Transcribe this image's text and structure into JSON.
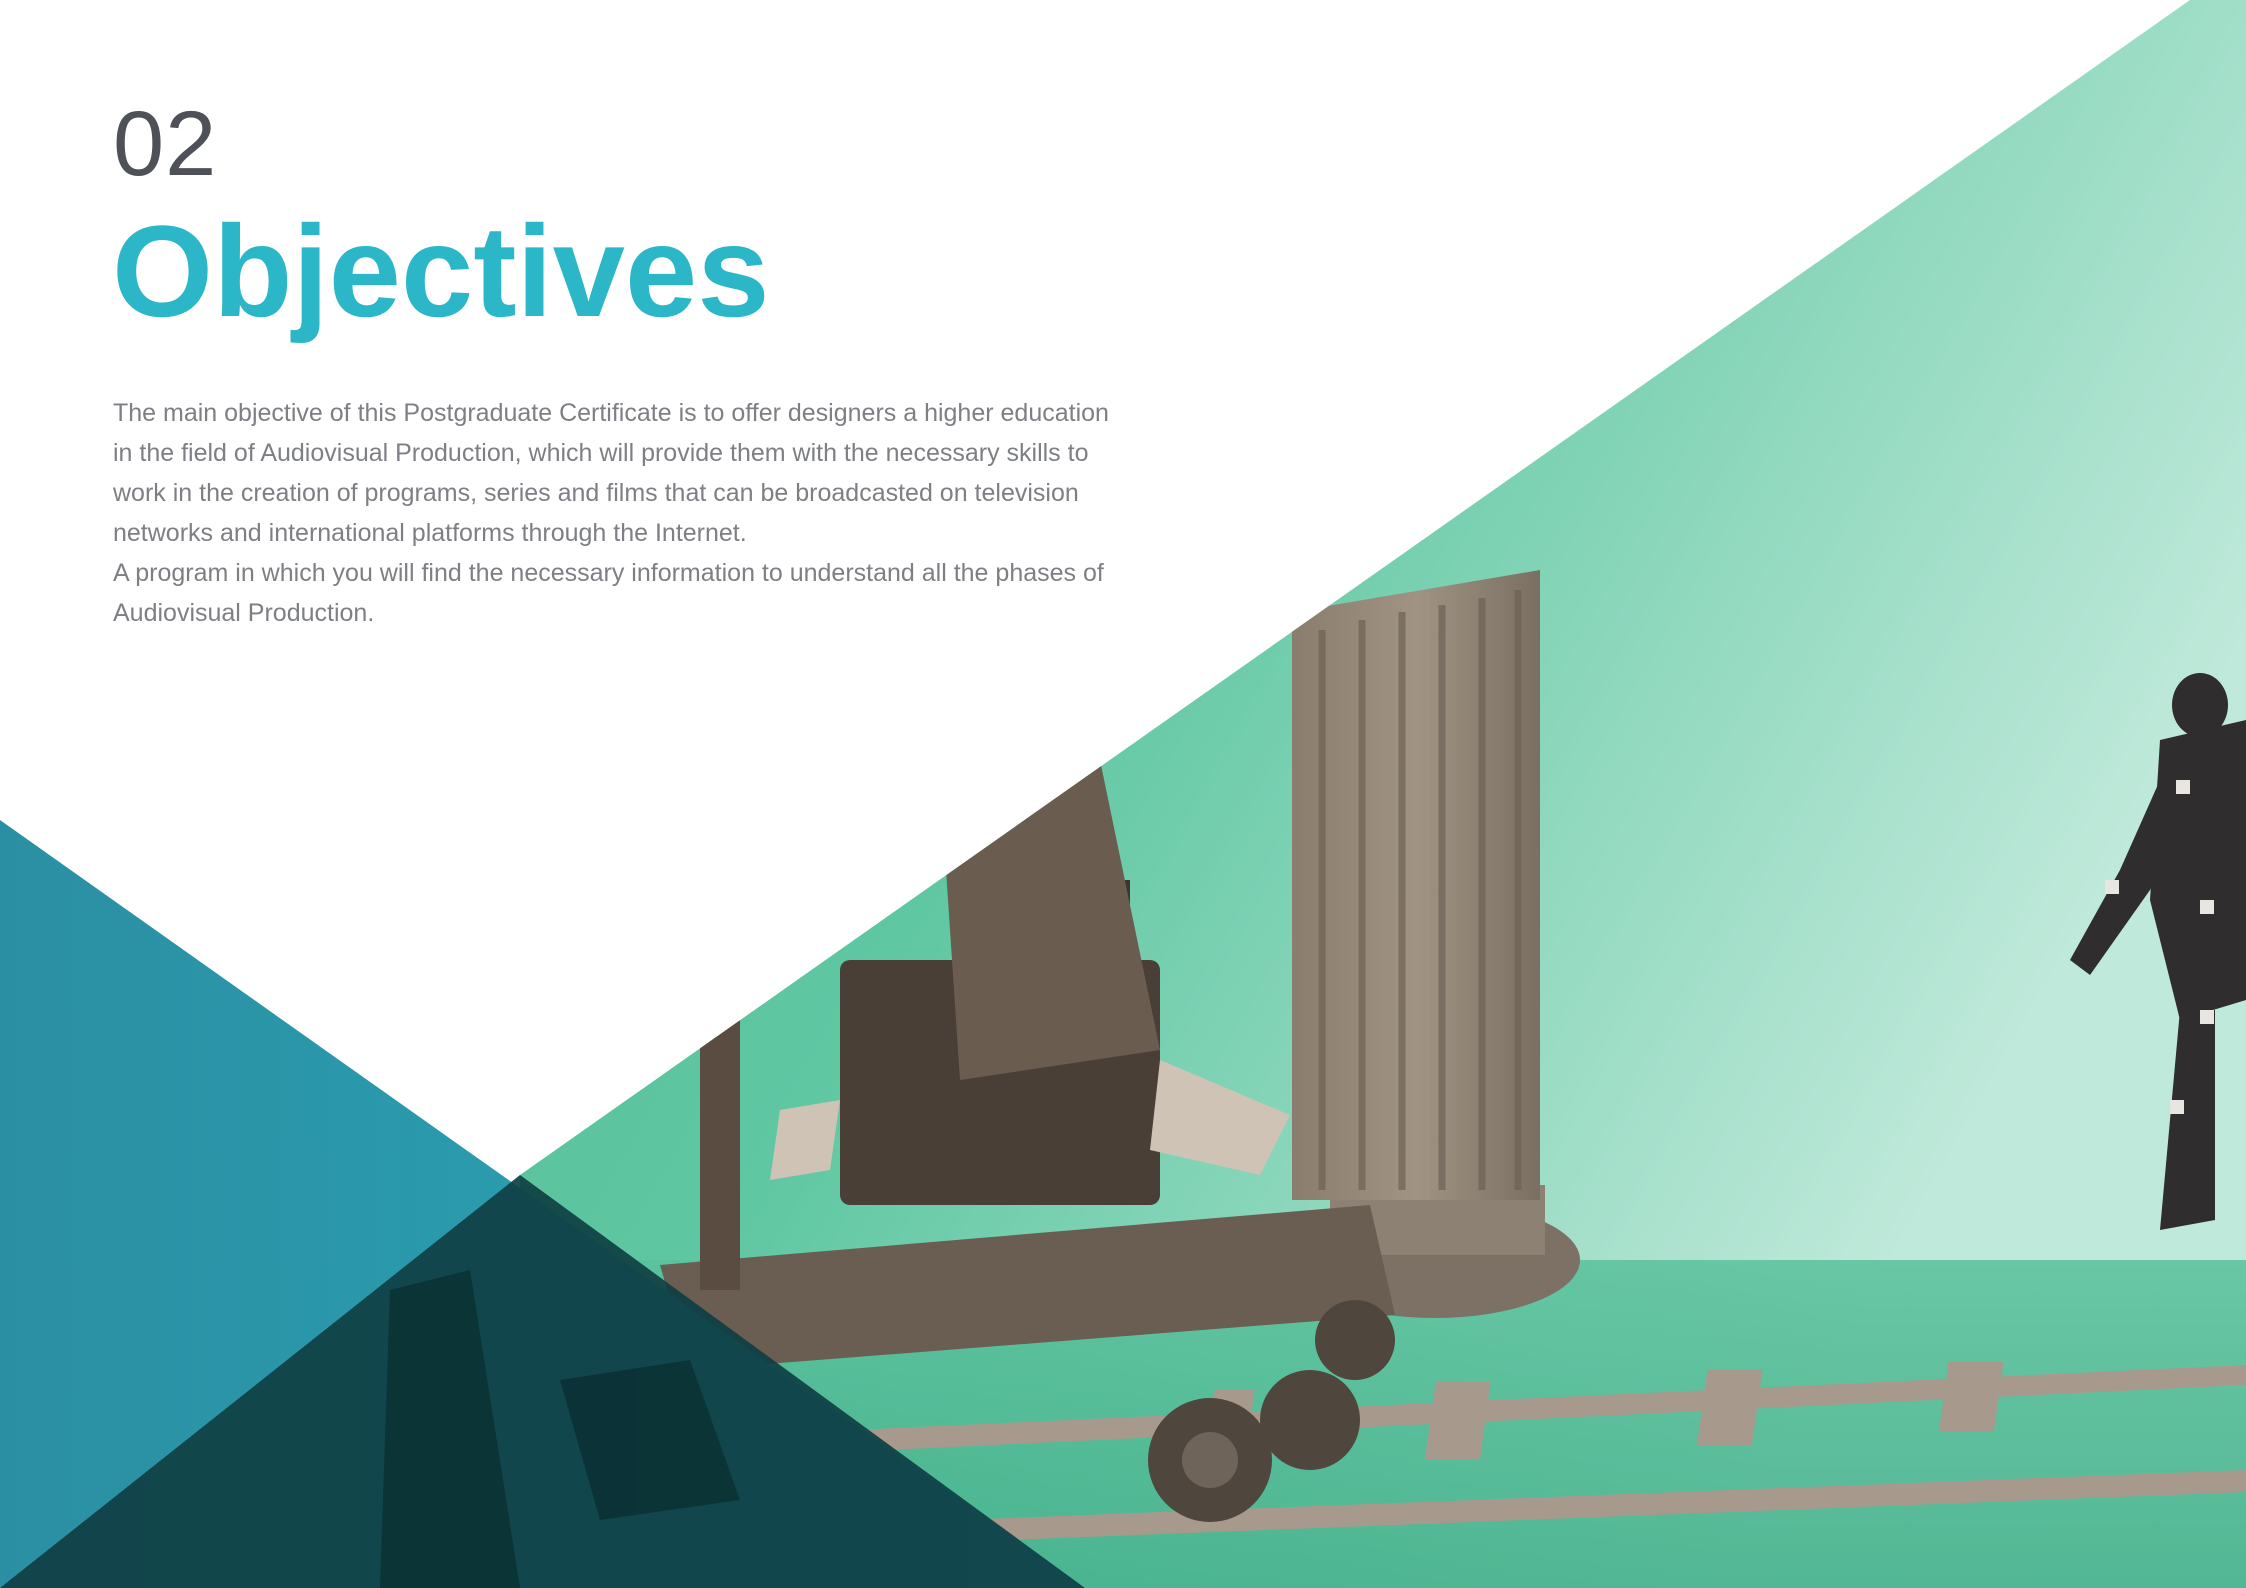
{
  "section": {
    "number": "02",
    "title": "Objectives"
  },
  "body": {
    "paragraph_1": "The main objective of this Postgraduate Certificate is to offer designers a higher education in the field of Audiovisual Production, which will provide them with the necessary skills to work in the creation of programs, series and films that can be broadcasted on television networks and international platforms through the Internet.",
    "paragraph_2": "A program in which you will find the necessary information to understand all the phases of Audiovisual Production."
  },
  "colors": {
    "title_accent": "#2bb7c7",
    "number": "#4e5157",
    "body_text": "#7d7f84",
    "teal_triangle": "#2aa6b7",
    "dark_triangle": "#0f3f43",
    "greenscreen": "#5ec9a3"
  }
}
